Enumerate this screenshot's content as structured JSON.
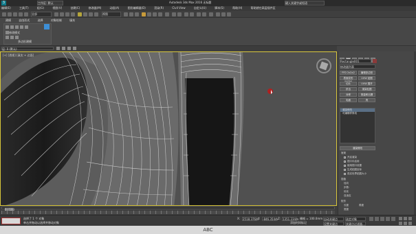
{
  "titlebar": {
    "logo": "3",
    "workspace": "工作区: 默认",
    "title": "Autodesk 3ds Max 2016    无标题",
    "search_placeholder": "键入关键字或短语",
    "minimize": "–",
    "maximize": "□",
    "close": "✕"
  },
  "menubar": {
    "items": [
      "编辑(E)",
      "工具(T)",
      "组(G)",
      "视图(V)",
      "创建(C)",
      "修改器(M)",
      "动画(A)",
      "图形编辑器(D)",
      "渲染(R)",
      "Civil View",
      "自定义(U)",
      "脚本(S)",
      "帮助(H)",
      "帮助就在高层插件区"
    ]
  },
  "toolbar": {
    "filter": "全部",
    "view": "视图"
  },
  "ribbon": {
    "tabs": [
      "建模",
      "自由形式",
      "选择",
      "对象绘制",
      "填充"
    ],
    "panel_label": "多边形建模",
    "panel_item": "修改模式"
  },
  "viewport_bar": {
    "scene_explorer": "层: 0 (默认)"
  },
  "viewport": {
    "label": "[+] [透视] [真实 + 边面]",
    "border_color": "#d8c63a",
    "cursor_color": "#b02020"
  },
  "command_panel": {
    "object_name": "Rectangle001",
    "modifier_list": "修改器列表",
    "buttons": [
      [
        "FFD 2x2x2",
        "编辑多边形"
      ],
      [
        "表面变形 (WSM)",
        "UVW 贴图"
      ],
      [
        "切片",
        "UVW 展开"
      ],
      [
        "挤出",
        "渲染贴图"
      ],
      [
        "对称",
        "测量和出漏"
      ],
      [
        "毛面",
        "壳"
      ]
    ],
    "stack": [
      "渲染修改",
      "可编辑样条线"
    ],
    "rollout_title": "渲染修改",
    "options_title": "常规",
    "options": [
      "开启渲染",
      "视口中启用",
      "使用视口设置",
      "生成贴图坐标",
      "真实世界贴图大小"
    ],
    "group2_title": "插值",
    "group2": [
      "径向",
      "步数:",
      "优化",
      "自适应"
    ],
    "group3_title": "矩形",
    "group3": [
      "长度",
      "宽度",
      "角度"
    ]
  },
  "timeline": {
    "frame": "0 / 100"
  },
  "statusbar": {
    "selection": "选择了 1 个 对象",
    "prompt": "单击并拖动以选择并移动对象",
    "x_label": "X:",
    "x": "2518.376m",
    "y_label": "Y:",
    "y": "-846.354m",
    "z_label": "Z:",
    "z": "1351.234m",
    "grid": "栅格 = 100.0mm",
    "add_tag": "添加时间标记",
    "auto_key": "自动关键点",
    "set_key": "设置关键点",
    "selected": "选定对象",
    "key_filter": "关键点过滤器..."
  },
  "caption": "ABC"
}
